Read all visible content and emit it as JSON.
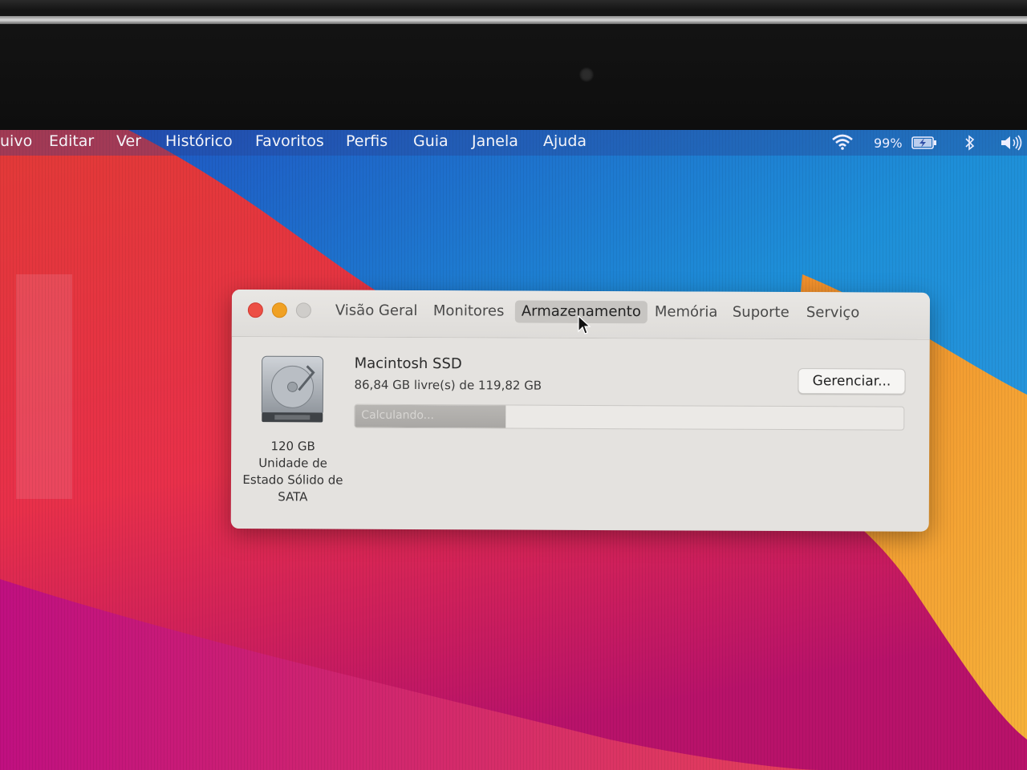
{
  "menubar": {
    "items": [
      "uivo",
      "Editar",
      "Ver",
      "Histórico",
      "Favoritos",
      "Perfis",
      "Guia",
      "Janela",
      "Ajuda"
    ],
    "battery_percent": "99%",
    "icons": [
      "wifi-icon",
      "battery-charging-icon",
      "bluetooth-icon",
      "volume-icon"
    ]
  },
  "window": {
    "traffic_lights": {
      "close": "#ec4f45",
      "minimize": "#f0a124",
      "zoom": "#cfcdca"
    },
    "tabs": [
      {
        "label": "Visão Geral",
        "active": false
      },
      {
        "label": "Monitores",
        "active": false
      },
      {
        "label": "Armazenamento",
        "active": true
      },
      {
        "label": "Memória",
        "active": false
      },
      {
        "label": "Suporte",
        "active": false
      },
      {
        "label": "Serviço",
        "active": false
      }
    ]
  },
  "storage": {
    "disk_caption": [
      "120 GB",
      "Unidade de",
      "Estado Sólido de",
      "SATA"
    ],
    "volume_name": "Macintosh SSD",
    "free_text": "86,84 GB livre(s) de 119,82 GB",
    "manage_label": "Gerenciar...",
    "bar_label": "Calculando...",
    "bar_fill_fraction": 0.275
  }
}
